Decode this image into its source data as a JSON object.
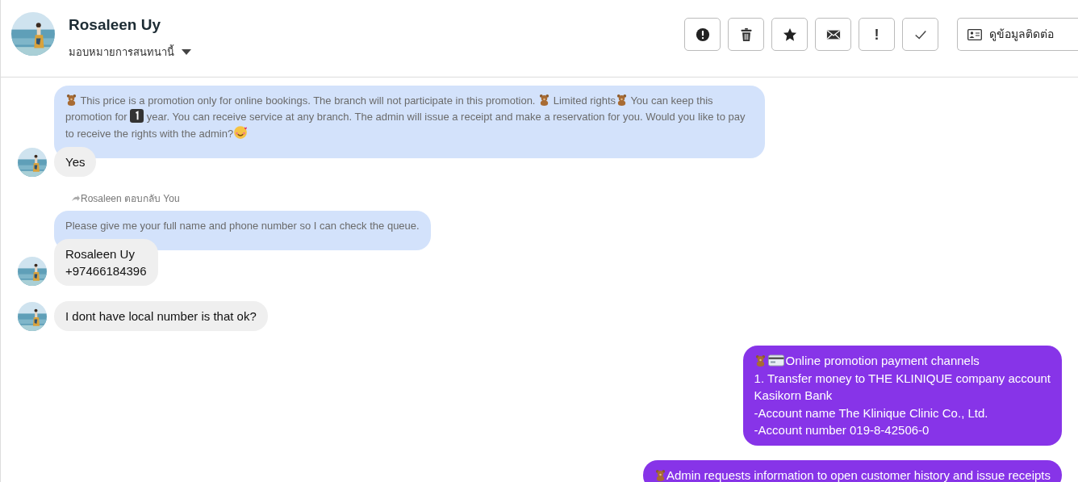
{
  "header": {
    "name": "Rosaleen Uy",
    "assign_label": "มอบหมายการสนทนานี้",
    "actions": [
      {
        "kind": "alert"
      },
      {
        "kind": "trash"
      },
      {
        "kind": "star"
      },
      {
        "kind": "mail"
      },
      {
        "kind": "exclaim",
        "text": "!"
      },
      {
        "kind": "check"
      }
    ],
    "contact_button": "ดูข้อมูลติดต่อ"
  },
  "messages": [
    {
      "kind": "page",
      "segments": [
        {
          "kind": "bear"
        },
        {
          "kind": "text",
          "text": " This price is a promotion only for online bookings. The branch will not participate in this promotion. "
        },
        {
          "kind": "bear"
        },
        {
          "kind": "text",
          "text": " Limited rights"
        },
        {
          "kind": "bear"
        },
        {
          "kind": "text",
          "text": "  You can keep this promotion for "
        },
        {
          "kind": "one"
        },
        {
          "kind": "text",
          "text": " year. You can receive service at any branch. The admin will issue a receipt and make a reservation for you. Would you like to pay to receive the rights with the admin?"
        },
        {
          "kind": "smile"
        }
      ]
    },
    {
      "kind": "customer",
      "lines": [
        "Yes"
      ]
    },
    {
      "kind": "reply_note",
      "text": "Rosaleen ตอบกลับ You"
    },
    {
      "kind": "page",
      "segments": [
        {
          "kind": "text",
          "text": "Please give me your full name and phone number so I can check the queue."
        }
      ]
    },
    {
      "kind": "customer",
      "lines": [
        "Rosaleen Uy",
        "+97466184396"
      ]
    },
    {
      "kind": "customer",
      "lines": [
        "I dont have local number is that ok?"
      ]
    },
    {
      "kind": "agent",
      "segments": [
        {
          "kind": "bear"
        },
        {
          "kind": "card"
        },
        {
          "kind": "text",
          "text": "Online promotion payment channels"
        }
      ],
      "lines": [
        "1. Transfer money to THE KLINIQUE company account",
        "Kasikorn Bank",
        "-Account name The Klinique Clinic Co., Ltd.",
        "-Account number 019-8-42506-0"
      ]
    },
    {
      "kind": "agent",
      "segments": [
        {
          "kind": "bear"
        },
        {
          "kind": "text",
          "text": "Admin requests information to open customer history and issue receipts"
        }
      ]
    }
  ]
}
